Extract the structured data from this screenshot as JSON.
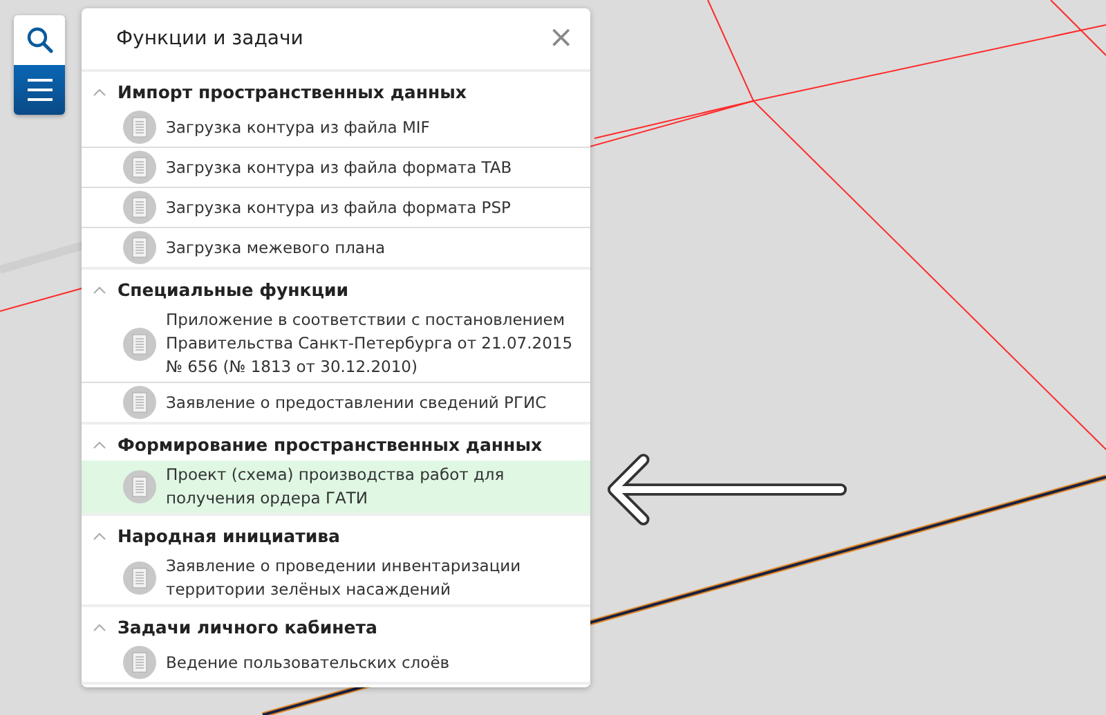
{
  "toolbar": {
    "buttons": [
      {
        "kind": "search",
        "selected": false
      },
      {
        "kind": "menu",
        "selected": true
      }
    ]
  },
  "panel": {
    "title": "Функции и задачи",
    "close": "×",
    "groups": [
      {
        "title": "Импорт пространственных данных",
        "expanded": true,
        "items": [
          {
            "label": "Загрузка контура из файла MIF",
            "selected": false
          },
          {
            "label": "Загрузка контура из файла формата TAB",
            "selected": false
          },
          {
            "label": "Загрузка контура из файла формата PSP",
            "selected": false
          },
          {
            "label": "Загрузка межевого плана",
            "selected": false
          }
        ]
      },
      {
        "title": "Специальные функции",
        "expanded": true,
        "items": [
          {
            "label": "Приложение в соответствии с постановлением Правительства Санкт-Петербурга от 21.07.2015 № 656 (№ 1813 от 30.12.2010)",
            "selected": false
          },
          {
            "label": "Заявление о предоставлении сведений РГИС",
            "selected": false
          }
        ]
      },
      {
        "title": "Формирование пространственных данных",
        "expanded": true,
        "items": [
          {
            "label": "Проект (схема) производства работ для получения ордера ГАТИ",
            "selected": true
          }
        ]
      },
      {
        "title": "Народная инициатива",
        "expanded": true,
        "items": [
          {
            "label": "Заявление о проведении инвентаризации территории зелёных насаждений",
            "selected": false
          }
        ]
      },
      {
        "title": "Задачи личного кабинета",
        "expanded": true,
        "items": [
          {
            "label": "Ведение пользовательских слоёв",
            "selected": false
          }
        ]
      }
    ]
  }
}
